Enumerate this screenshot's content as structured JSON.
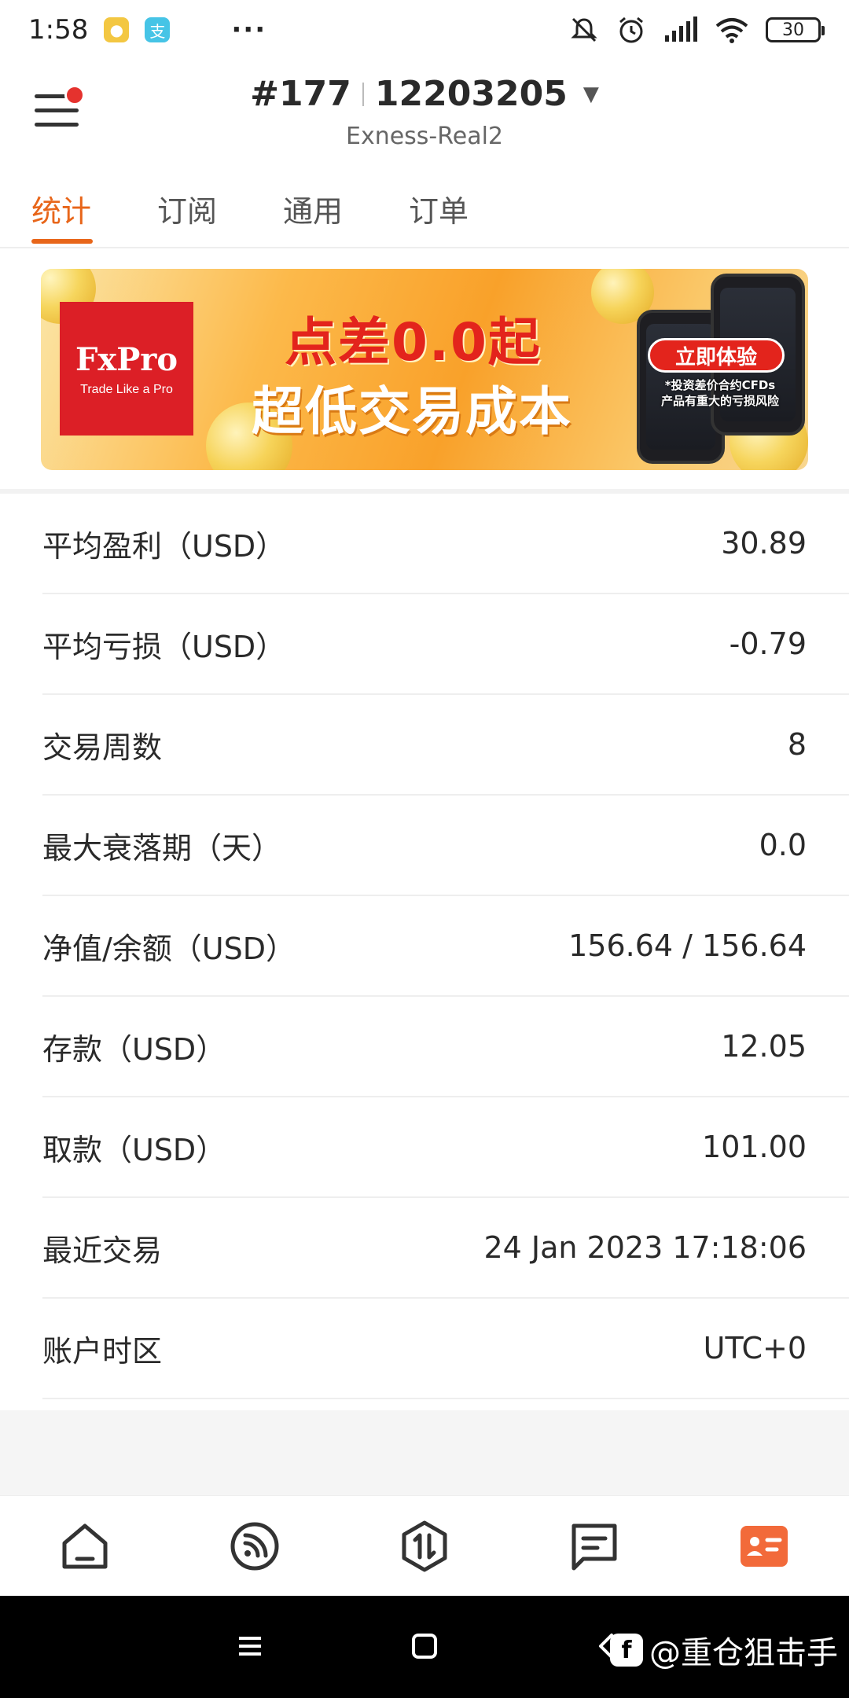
{
  "status_bar": {
    "time": "1:58",
    "app_icons": [
      "message-icon",
      "alipay-icon"
    ],
    "more": "···",
    "battery": "30"
  },
  "header": {
    "rank": "#177",
    "account": "12203205",
    "server": "Exness-Real2"
  },
  "tabs": [
    {
      "label": "统计",
      "active": true
    },
    {
      "label": "订阅",
      "active": false
    },
    {
      "label": "通用",
      "active": false
    },
    {
      "label": "订单",
      "active": false
    }
  ],
  "banner": {
    "brand": "FxPro",
    "slogan": "Trade Like a Pro",
    "line1": "点差0.0起",
    "line2": "超低交易成本",
    "cta": "立即体验",
    "risk_line1": "*投资差价合约CFDs",
    "risk_line2": "产品有重大的亏损风险"
  },
  "stats": [
    {
      "label": "平均盈利（USD）",
      "value": "30.89"
    },
    {
      "label": "平均亏损（USD）",
      "value": "-0.79"
    },
    {
      "label": "交易周数",
      "value": "8"
    },
    {
      "label": "最大衰落期（天）",
      "value": "0.0"
    },
    {
      "label": "净值/余额（USD）",
      "value": "156.64 / 156.64"
    },
    {
      "label": "存款（USD）",
      "value": "12.05"
    },
    {
      "label": "取款（USD）",
      "value": "101.00"
    },
    {
      "label": "最近交易",
      "value": "24 Jan 2023 17:18:06"
    },
    {
      "label": "账户时区",
      "value": "UTC+0"
    }
  ],
  "bottom_nav": [
    {
      "icon": "home-icon",
      "active": false
    },
    {
      "icon": "feed-icon",
      "active": false
    },
    {
      "icon": "trade-icon",
      "active": false
    },
    {
      "icon": "messages-icon",
      "active": false
    },
    {
      "icon": "profile-card-icon",
      "active": true
    }
  ],
  "watermark": "@重仓狙击手",
  "colors": {
    "accent": "#e8661a",
    "active_nav": "#f26a3a",
    "banner_red": "#e3241c"
  }
}
